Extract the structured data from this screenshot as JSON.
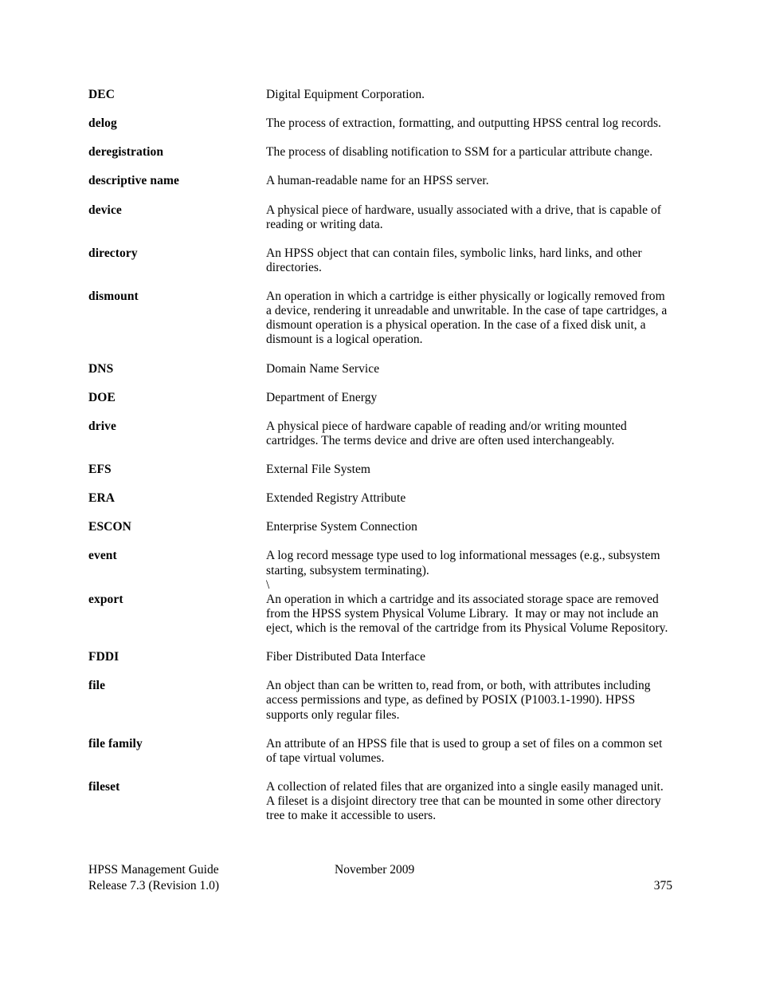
{
  "document": {
    "type": "glossary-page",
    "title": "HPSS Management Guide",
    "page_number": "375"
  },
  "glossary": {
    "entries": [
      {
        "term": "DEC",
        "lines": [
          "Digital Equipment Corporation."
        ]
      },
      {
        "term": "delog",
        "lines": [
          "The process of extraction, formatting, and outputting HPSS central log records."
        ]
      },
      {
        "term": "deregistration",
        "lines": [
          "The process of disabling notification to SSM for a particular attribute change."
        ]
      },
      {
        "term": "descriptive name",
        "lines": [
          "A human-readable name for an HPSS server."
        ]
      },
      {
        "term": "device",
        "lines": [
          "A physical piece of hardware, usually associated with a drive, that is capable of",
          "reading or writing data."
        ]
      },
      {
        "term": "directory",
        "lines": [
          "An HPSS object that can contain files, symbolic links, hard links, and other",
          "directories."
        ]
      },
      {
        "term": "dismount",
        "lines": [
          "An operation in which a cartridge is either physically or logically removed from",
          "a device, rendering it unreadable and unwritable. In the case of tape cartridges, a",
          "dismount operation is a physical operation. In the case of a fixed disk unit, a",
          "dismount is a logical operation."
        ]
      },
      {
        "term": "DNS",
        "lines": [
          "Domain Name Service"
        ]
      },
      {
        "term": "DOE",
        "lines": [
          "Department of Energy"
        ]
      },
      {
        "term": "drive",
        "lines": [
          "A physical piece of hardware capable of reading and/or writing mounted",
          "cartridges. The terms device and drive are often used interchangeably."
        ]
      },
      {
        "term": "EFS",
        "lines": [
          "External File System"
        ]
      },
      {
        "term": "ERA",
        "lines": [
          "Extended Registry Attribute"
        ]
      },
      {
        "term": "ESCON",
        "lines": [
          "Enterprise System Connection"
        ]
      },
      {
        "term": "event",
        "lines": [
          "A log record message type used to log informational messages (e.g., subsystem",
          "starting, subsystem terminating).",
          "\\"
        ],
        "tight_below": true
      },
      {
        "term": "export",
        "lines": [
          "An operation in which a cartridge and its associated storage space are removed",
          "from the HPSS system Physical Volume Library.  It may or may not include an",
          "eject, which is the removal of the cartridge from its Physical Volume Repository."
        ]
      },
      {
        "term": "FDDI",
        "lines": [
          "Fiber Distributed Data Interface"
        ]
      },
      {
        "term": "file",
        "lines": [
          "An object than can be written to, read from, or both, with attributes including",
          "access permissions and type, as defined by POSIX (P1003.1-1990). HPSS",
          "supports only regular files."
        ]
      },
      {
        "term": "file family",
        "lines": [
          "An attribute of an HPSS file that is used to group a set of files on a common set",
          "of tape virtual volumes."
        ]
      },
      {
        "term": "fileset",
        "lines": [
          "A collection of related files that are organized into a single easily managed unit.",
          "A fileset is a disjoint directory tree that can be mounted in some other directory",
          "tree to make it accessible to users."
        ]
      }
    ]
  },
  "footer": {
    "guide_title": "HPSS Management Guide",
    "release": "Release 7.3 (Revision 1.0)",
    "date": "November 2009",
    "page_number": "375"
  }
}
